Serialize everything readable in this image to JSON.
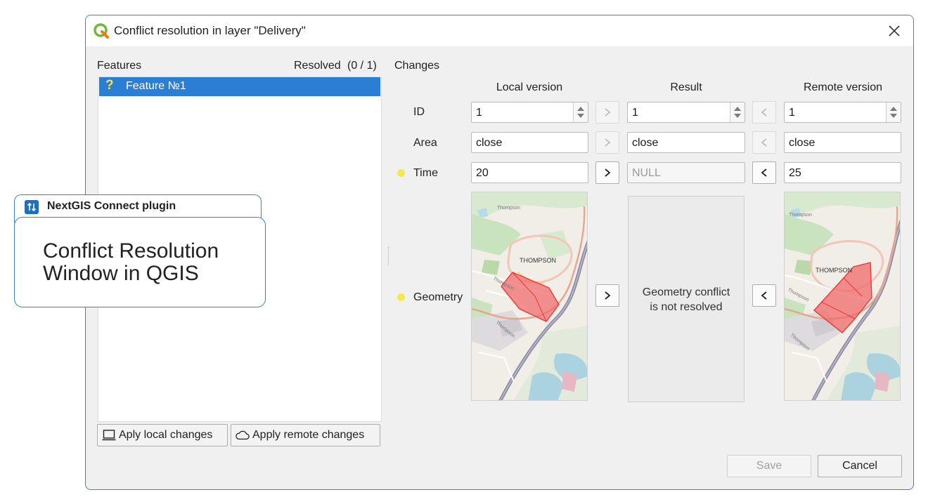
{
  "dialog": {
    "title": "Conflict resolution in layer \"Delivery\""
  },
  "features": {
    "header": "Features",
    "resolved_label": "Resolved",
    "resolved_count": "(0 / 1)",
    "items": [
      {
        "label": "Feature №1",
        "status_icon": "question-icon"
      }
    ],
    "apply_local_label": "Aply local changes",
    "apply_remote_label": "Apply remote changes"
  },
  "changes": {
    "header": "Changes",
    "col_local": "Local version",
    "col_result": "Result",
    "col_remote": "Remote version",
    "rows": [
      {
        "label": "ID",
        "local": "1",
        "result": "1",
        "remote": "1"
      },
      {
        "label": "Area",
        "local": "close",
        "result": "close",
        "remote": "close"
      },
      {
        "label": "Time",
        "local": "20",
        "result": "NULL",
        "remote": "25"
      },
      {
        "label": "Geometry"
      }
    ],
    "geometry_message": "Geometry conflict\nis not resolved",
    "map_labels": {
      "place": "THOMPSON",
      "road": "Thompson"
    }
  },
  "footer": {
    "save_label": "Save",
    "cancel_label": "Cancel"
  },
  "callout": {
    "tab_label": "NextGIS Connect plugin",
    "caption_line1": "Conflict Resolution",
    "caption_line2": "Window in QGIS"
  },
  "colors": {
    "accent": "#3b84c4",
    "selection": "#2a7fd4",
    "conflict_dot": "#f5e94a",
    "polygon": "#f06a6a"
  }
}
